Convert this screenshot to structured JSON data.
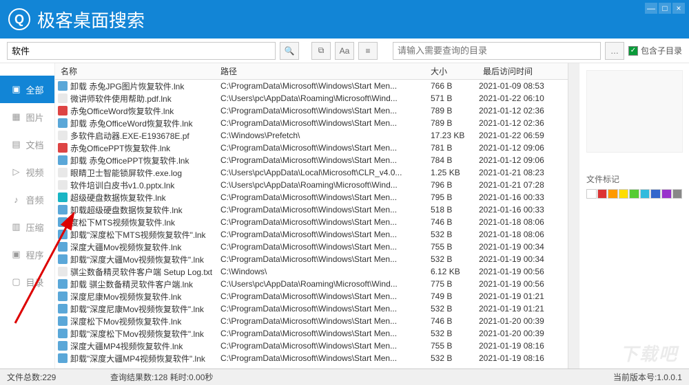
{
  "title": "极客桌面搜索",
  "window_controls": {
    "min": "—",
    "max": "□",
    "close": "×"
  },
  "search": {
    "value": "软件",
    "dir_placeholder": "请输入需要查询的目录",
    "subdir_label": "包含子目录"
  },
  "toolbar_buttons": [
    "search",
    "copy",
    "Aa",
    "filter"
  ],
  "sidebar": {
    "items": [
      {
        "icon": "folder-icon",
        "label": "全部",
        "active": true
      },
      {
        "icon": "image-icon",
        "label": "图片"
      },
      {
        "icon": "doc-icon",
        "label": "文档"
      },
      {
        "icon": "video-icon",
        "label": "视频"
      },
      {
        "icon": "audio-icon",
        "label": "音频"
      },
      {
        "icon": "archive-icon",
        "label": "压缩"
      },
      {
        "icon": "program-icon",
        "label": "程序"
      },
      {
        "icon": "dir-icon",
        "label": "目录"
      }
    ]
  },
  "columns": {
    "name": "名称",
    "path": "路径",
    "size": "大小",
    "time": "最后访问时间"
  },
  "rows": [
    {
      "ic": "#5aa7d8",
      "name": "卸载 赤兔JPG图片恢复软件.lnk",
      "path": "C:\\ProgramData\\Microsoft\\Windows\\Start Men...",
      "size": "766 B",
      "time": "2021-01-09 08:53"
    },
    {
      "ic": "#e8e8e8",
      "name": "微讲师软件使用帮助.pdf.lnk",
      "path": "C:\\Users\\pc\\AppData\\Roaming\\Microsoft\\Wind...",
      "size": "571 B",
      "time": "2021-01-22 06:10"
    },
    {
      "ic": "#d44",
      "name": "赤兔OfficeWord恢复软件.lnk",
      "path": "C:\\ProgramData\\Microsoft\\Windows\\Start Men...",
      "size": "789 B",
      "time": "2021-01-12 02:36"
    },
    {
      "ic": "#5aa7d8",
      "name": "卸载 赤兔OfficeWord恢复软件.lnk",
      "path": "C:\\ProgramData\\Microsoft\\Windows\\Start Men...",
      "size": "789 B",
      "time": "2021-01-12 02:36"
    },
    {
      "ic": "#e8e8e8",
      "name": "多软件启动器.EXE-E193678E.pf",
      "path": "C:\\Windows\\Prefetch\\",
      "size": "17.23 KB",
      "time": "2021-01-22 06:59"
    },
    {
      "ic": "#d44",
      "name": "赤兔OfficePPT恢复软件.lnk",
      "path": "C:\\ProgramData\\Microsoft\\Windows\\Start Men...",
      "size": "781 B",
      "time": "2021-01-12 09:06"
    },
    {
      "ic": "#5aa7d8",
      "name": "卸载 赤兔OfficePPT恢复软件.lnk",
      "path": "C:\\ProgramData\\Microsoft\\Windows\\Start Men...",
      "size": "784 B",
      "time": "2021-01-12 09:06"
    },
    {
      "ic": "#e8e8e8",
      "name": "眼睛卫士智能锁屏软件.exe.log",
      "path": "C:\\Users\\pc\\AppData\\Local\\Microsoft\\CLR_v4.0...",
      "size": "1.25 KB",
      "time": "2021-01-21 08:23"
    },
    {
      "ic": "#e8e8e8",
      "name": "软件培训白皮书v1.0.pptx.lnk",
      "path": "C:\\Users\\pc\\AppData\\Roaming\\Microsoft\\Wind...",
      "size": "796 B",
      "time": "2021-01-21 07:28"
    },
    {
      "ic": "#19b5c4",
      "name": "超级硬盘数据恢复软件.lnk",
      "path": "C:\\ProgramData\\Microsoft\\Windows\\Start Men...",
      "size": "795 B",
      "time": "2021-01-16 00:33"
    },
    {
      "ic": "#5aa7d8",
      "name": "卸载超级硬盘数据恢复软件.lnk",
      "path": "C:\\ProgramData\\Microsoft\\Windows\\Start Men...",
      "size": "518 B",
      "time": "2021-01-16 00:33"
    },
    {
      "ic": "#5aa7d8",
      "name": "度松下MTS视频恢复软件.lnk",
      "path": "C:\\ProgramData\\Microsoft\\Windows\\Start Men...",
      "size": "746 B",
      "time": "2021-01-18 08:06"
    },
    {
      "ic": "#5aa7d8",
      "name": "卸载\"深度松下MTS视频恢复软件\".lnk",
      "path": "C:\\ProgramData\\Microsoft\\Windows\\Start Men...",
      "size": "532 B",
      "time": "2021-01-18 08:06"
    },
    {
      "ic": "#5aa7d8",
      "name": "深度大疆Mov视频恢复软件.lnk",
      "path": "C:\\ProgramData\\Microsoft\\Windows\\Start Men...",
      "size": "755 B",
      "time": "2021-01-19 00:34"
    },
    {
      "ic": "#5aa7d8",
      "name": "卸载\"深度大疆Mov视频恢复软件\".lnk",
      "path": "C:\\ProgramData\\Microsoft\\Windows\\Start Men...",
      "size": "532 B",
      "time": "2021-01-19 00:34"
    },
    {
      "ic": "#e8e8e8",
      "name": "骐尘数备精灵软件客户端 Setup Log.txt",
      "path": "C:\\Windows\\",
      "size": "6.12 KB",
      "time": "2021-01-19 00:56"
    },
    {
      "ic": "#5aa7d8",
      "name": "卸载 骐尘数备精灵软件客户端.lnk",
      "path": "C:\\Users\\pc\\AppData\\Roaming\\Microsoft\\Wind...",
      "size": "775 B",
      "time": "2021-01-19 00:56"
    },
    {
      "ic": "#5aa7d8",
      "name": "深度尼康Mov视频恢复软件.lnk",
      "path": "C:\\ProgramData\\Microsoft\\Windows\\Start Men...",
      "size": "749 B",
      "time": "2021-01-19 01:21"
    },
    {
      "ic": "#5aa7d8",
      "name": "卸载\"深度尼康Mov视频恢复软件\".lnk",
      "path": "C:\\ProgramData\\Microsoft\\Windows\\Start Men...",
      "size": "532 B",
      "time": "2021-01-19 01:21"
    },
    {
      "ic": "#5aa7d8",
      "name": "深度松下Mov视频恢复软件.lnk",
      "path": "C:\\ProgramData\\Microsoft\\Windows\\Start Men...",
      "size": "746 B",
      "time": "2021-01-20 00:39"
    },
    {
      "ic": "#5aa7d8",
      "name": "卸载\"深度松下Mov视频恢复软件\".lnk",
      "path": "C:\\ProgramData\\Microsoft\\Windows\\Start Men...",
      "size": "532 B",
      "time": "2021-01-20 00:39"
    },
    {
      "ic": "#5aa7d8",
      "name": "深度大疆MP4视频恢复软件.lnk",
      "path": "C:\\ProgramData\\Microsoft\\Windows\\Start Men...",
      "size": "755 B",
      "time": "2021-01-19 08:16"
    },
    {
      "ic": "#5aa7d8",
      "name": "卸载\"深度大疆MP4视频恢复软件\".lnk",
      "path": "C:\\ProgramData\\Microsoft\\Windows\\Start Men...",
      "size": "532 B",
      "time": "2021-01-19 08:16"
    }
  ],
  "preview": {
    "tag_label": "文件标记",
    "colors": [
      "#ffffff",
      "#d33",
      "#f90",
      "#fd0",
      "#5c3",
      "#3bd",
      "#36c",
      "#93c",
      "#888"
    ]
  },
  "status": {
    "left": "文件总数:229",
    "mid": "查询结果数:128 耗时:0.00秒",
    "right": "当前版本号:1.0.0.1"
  },
  "watermark": "下载吧"
}
